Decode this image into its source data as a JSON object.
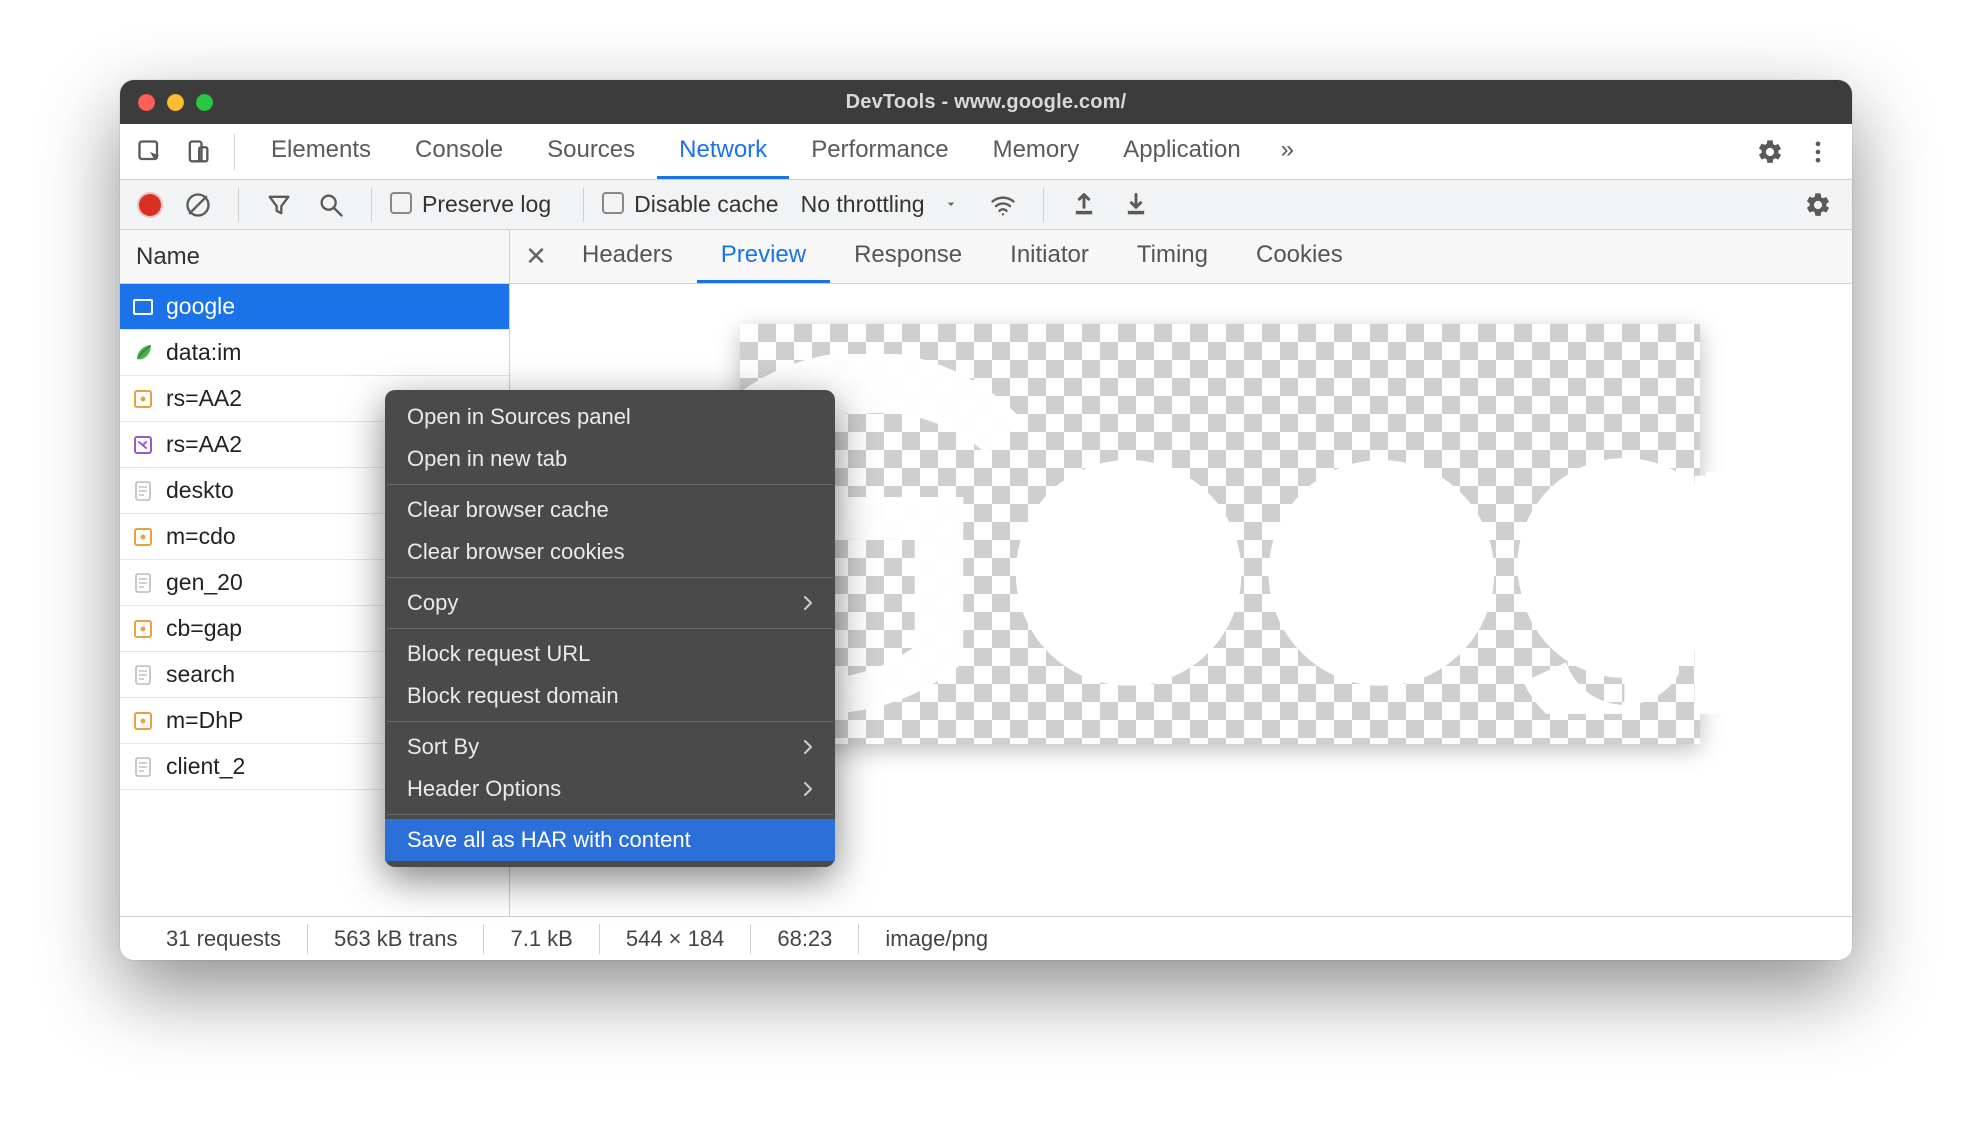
{
  "window": {
    "title": "DevTools - www.google.com/"
  },
  "mainTabs": {
    "items": [
      "Elements",
      "Console",
      "Sources",
      "Network",
      "Performance",
      "Memory",
      "Application"
    ],
    "active": "Network",
    "overflowGlyph": "»"
  },
  "netToolbar": {
    "preserveLog": "Preserve log",
    "disableCache": "Disable cache",
    "throttling": "No throttling"
  },
  "sidebar": {
    "header": "Name",
    "requests": [
      {
        "name": "google",
        "iconType": "img-blue",
        "selected": true
      },
      {
        "name": "data:im",
        "iconType": "leaf"
      },
      {
        "name": "rs=AA2",
        "iconType": "js"
      },
      {
        "name": "rs=AA2",
        "iconType": "css"
      },
      {
        "name": "deskto",
        "iconType": "doc"
      },
      {
        "name": "m=cdo",
        "iconType": "js"
      },
      {
        "name": "gen_20",
        "iconType": "doc"
      },
      {
        "name": "cb=gap",
        "iconType": "js"
      },
      {
        "name": "search",
        "iconType": "doc"
      },
      {
        "name": "m=DhP",
        "iconType": "js"
      },
      {
        "name": "client_2",
        "iconType": "doc"
      }
    ]
  },
  "detailTabs": {
    "items": [
      "Headers",
      "Preview",
      "Response",
      "Initiator",
      "Timing",
      "Cookies"
    ],
    "active": "Preview"
  },
  "statusbar": {
    "requests": "31 requests",
    "transferred": "563 kB trans",
    "resource": "7.1 kB",
    "dimensions": "544 × 184",
    "time": "68:23",
    "mime": "image/png"
  },
  "contextMenu": {
    "items": [
      {
        "label": "Open in Sources panel",
        "type": "item"
      },
      {
        "label": "Open in new tab",
        "type": "item"
      },
      {
        "type": "sep"
      },
      {
        "label": "Clear browser cache",
        "type": "item"
      },
      {
        "label": "Clear browser cookies",
        "type": "item"
      },
      {
        "type": "sep"
      },
      {
        "label": "Copy",
        "type": "submenu"
      },
      {
        "type": "sep"
      },
      {
        "label": "Block request URL",
        "type": "item"
      },
      {
        "label": "Block request domain",
        "type": "item"
      },
      {
        "type": "sep"
      },
      {
        "label": "Sort By",
        "type": "submenu"
      },
      {
        "label": "Header Options",
        "type": "submenu"
      },
      {
        "type": "sep"
      },
      {
        "label": "Save all as HAR with content",
        "type": "item",
        "highlight": true
      }
    ]
  }
}
